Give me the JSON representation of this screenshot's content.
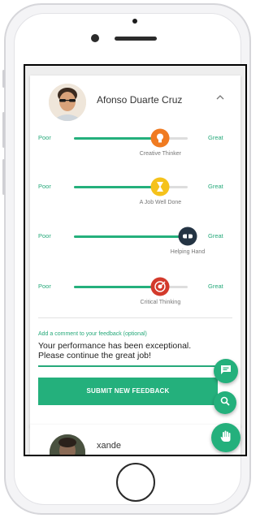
{
  "profile": {
    "name": "Afonso Duarte Cruz",
    "chevron_icon": "chevron-up-icon"
  },
  "ratings": [
    {
      "low": "Poor",
      "high": "Great",
      "label": "Creative Thinker",
      "value": 0.76,
      "icon": "lightbulb-icon",
      "badge_color": "#f07b21"
    },
    {
      "low": "Poor",
      "high": "Great",
      "label": "A Job Well Done",
      "value": 0.76,
      "icon": "hourglass-icon",
      "badge_color": "#f5c21b"
    },
    {
      "low": "Poor",
      "high": "Great",
      "label": "Helping Hand",
      "value": 1.0,
      "icon": "handshake-icon",
      "badge_color": "#243444"
    },
    {
      "low": "Poor",
      "high": "Great",
      "label": "Critical Thinking",
      "value": 0.76,
      "icon": "target-icon",
      "badge_color": "#d33a2c"
    }
  ],
  "comment": {
    "label": "Add a comment to your feedback (optional)",
    "value": "Your performance has been exceptional. Please continue the great job!"
  },
  "submit_label": "SUBMIT NEW FEEDBACK",
  "next_profile": {
    "name": "xande",
    "chevron_icon": "chevron-down-icon"
  },
  "fabs": [
    {
      "icon": "chat-icon"
    },
    {
      "icon": "search-icon"
    },
    {
      "icon": "hand-icon"
    }
  ],
  "colors": {
    "accent": "#24b07c",
    "track": "#dddddd"
  }
}
